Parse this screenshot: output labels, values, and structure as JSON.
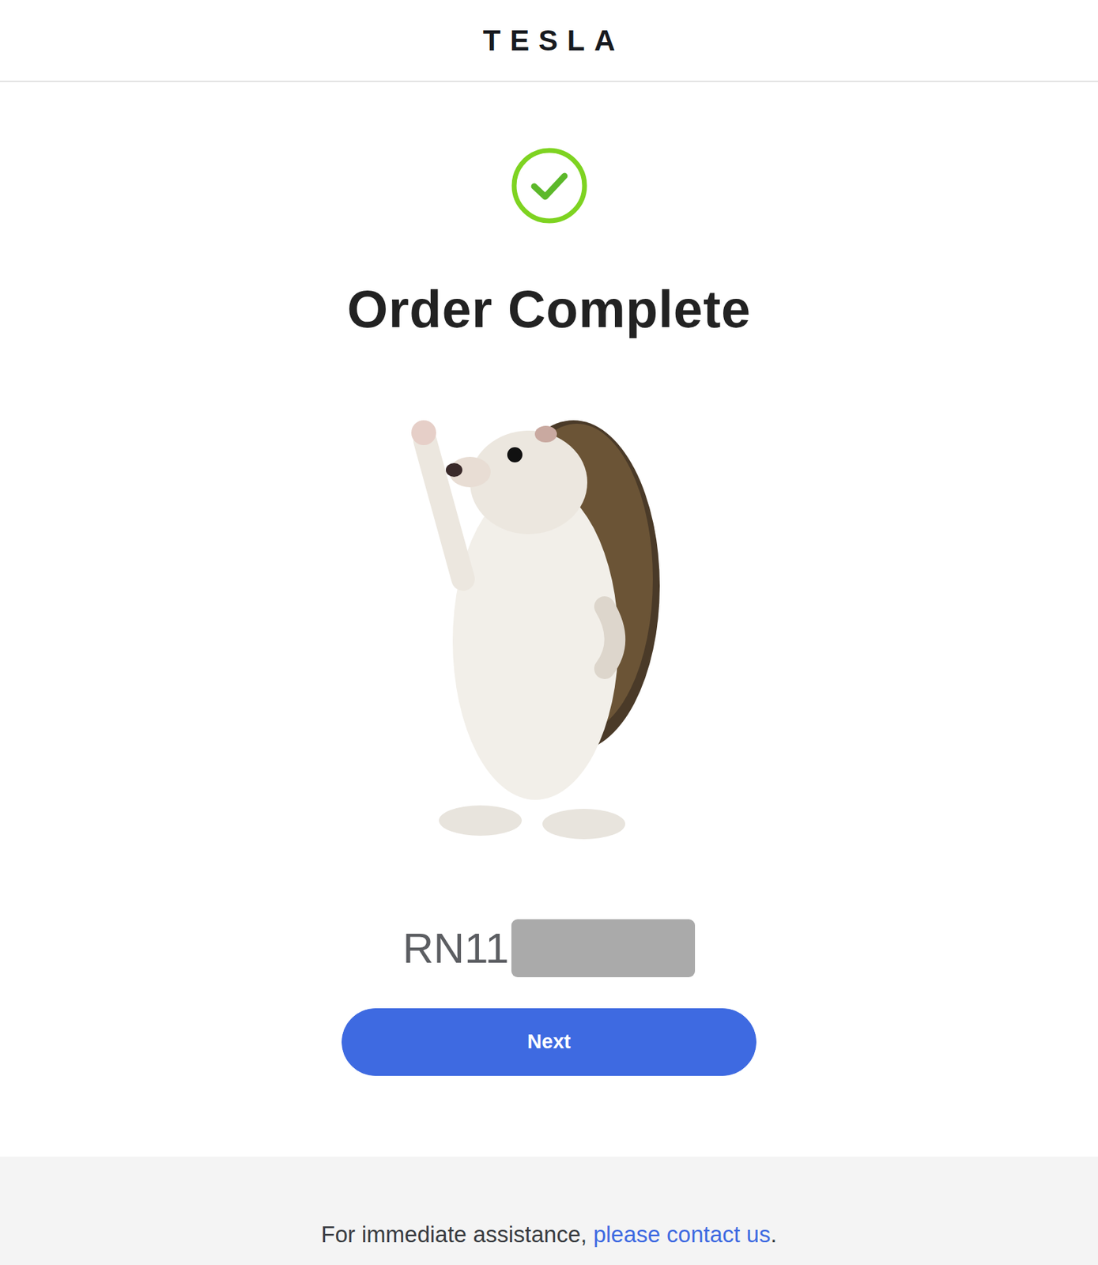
{
  "header": {
    "logo": "TESLA"
  },
  "title": "Order Complete",
  "order": {
    "number": "RN11",
    "redacted": true
  },
  "buttons": [
    "Next"
  ],
  "footer": {
    "text": "For immediate assistance, ",
    "link": "please contact us",
    "suffix": "."
  }
}
